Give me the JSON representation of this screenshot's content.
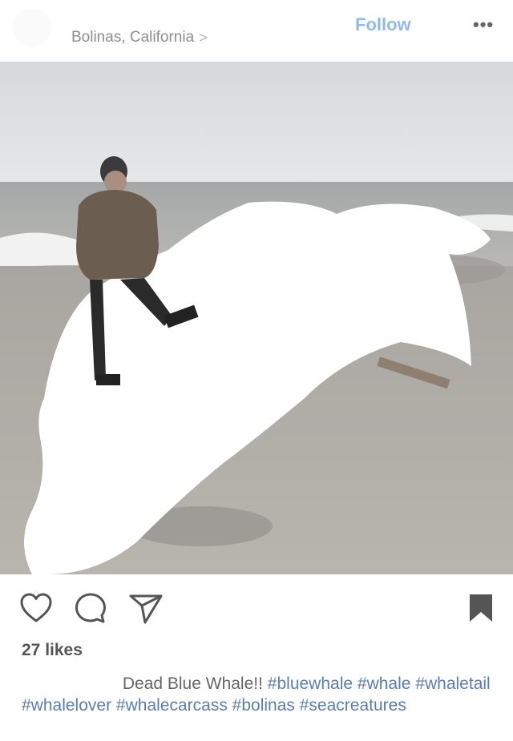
{
  "header": {
    "location": "Bolinas, California",
    "location_chevron": ">",
    "follow_label": "Follow",
    "more_label": "•••"
  },
  "photo": {
    "description_icon": "photo"
  },
  "actions": {
    "heart_icon": "heart-icon",
    "comment_icon": "comment-icon",
    "share_icon": "share-icon",
    "bookmark_icon": "bookmark-icon"
  },
  "likes": "27 likes",
  "caption": {
    "text": "Dead Blue Whale!!",
    "tags": [
      "#bluewhale",
      "#whale",
      "#whaletail",
      "#whalelover",
      "#whalecarcass",
      "#bolinas",
      "#seacreatures"
    ]
  },
  "colors": {
    "follow": "#8fbbe8",
    "hashtag": "#5b7eae",
    "bookmark": "#555555"
  }
}
